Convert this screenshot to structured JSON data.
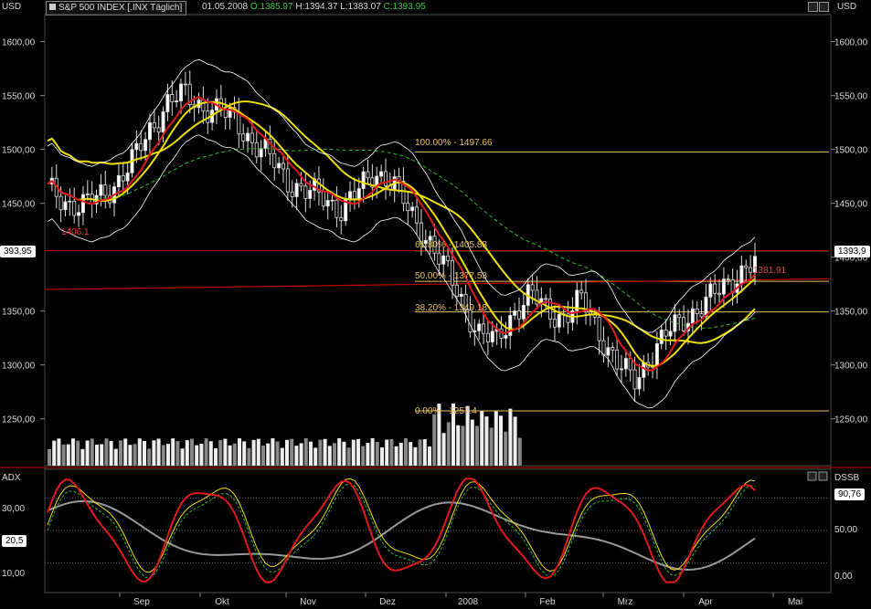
{
  "header": {
    "currency_left": "USD",
    "currency_right": "USD",
    "symbol": "S&P 500 INDEX [.INX  Täglich]",
    "date": "01.05.2008",
    "open": "O:1385.97",
    "high": "H:1394.37",
    "low": "L:1383.07",
    "close": "C:1393.95"
  },
  "price_panel": {
    "y_ticks": [
      "1600,00",
      "1550,00",
      "1500,00",
      "1450,00",
      "1350,00",
      "1300,00",
      "1250,00"
    ],
    "y_ticks_right": [
      "1600,00",
      "1550,00",
      "1500,00",
      "1450,00",
      "1400,00",
      "1350,00",
      "1300,00",
      "1250,00"
    ],
    "last_price_left": "393,95",
    "last_price_right": "1393,9",
    "resistance_label": "1406.1",
    "trendline_label": "1381.91",
    "fib_labels": [
      "100.00% - 1497.66",
      "61.80% - 1405.88",
      "50.00% - 1377.53",
      "38.20% - 1349.18",
      "0.00% - 1257.4"
    ]
  },
  "indicator_panel": {
    "left_label": "ADX",
    "right_label": "DSSB",
    "left_ticks": [
      "30,00",
      "10,00"
    ],
    "left_marker": "20,5",
    "right_ticks": [
      "50,00",
      "0,00"
    ],
    "right_marker": "90,76"
  },
  "x_axis": {
    "labels": [
      "Sep",
      "Okt",
      "Nov",
      "Dez",
      "2008",
      "Feb",
      "Mrz",
      "Apr",
      "Mai"
    ]
  },
  "colors": {
    "background": "#000000",
    "fib_line": "#e8c060",
    "ma_red": "#e0191c",
    "ma_yellow": "#f0e000",
    "ma_green_dash": "#2dbb2d",
    "band": "#ffffff",
    "adx": "#9a9a9a",
    "resistance": "#c00000"
  },
  "chart_data": {
    "type": "candlestick",
    "title": "S&P 500 INDEX [.INX  Täglich]",
    "xlabel": "",
    "ylabel": "USD",
    "ylim": [
      1215,
      1620
    ],
    "x_categories": [
      "Sep",
      "Okt",
      "Nov",
      "Dez",
      "2008",
      "Feb",
      "Mrz",
      "Apr",
      "Mai"
    ],
    "close_series_approx": [
      1462,
      1452,
      1448,
      1455,
      1470,
      1490,
      1520,
      1545,
      1550,
      1540,
      1535,
      1525,
      1505,
      1490,
      1470,
      1460,
      1455,
      1445,
      1460,
      1480,
      1470,
      1440,
      1420,
      1390,
      1360,
      1330,
      1320,
      1350,
      1365,
      1350,
      1345,
      1360,
      1330,
      1300,
      1285,
      1310,
      1330,
      1345,
      1355,
      1370,
      1385,
      1394
    ],
    "fibonacci_levels": [
      {
        "label": "100.00%",
        "value": 1497.66
      },
      {
        "label": "61.80%",
        "value": 1405.88
      },
      {
        "label": "50.00%",
        "value": 1377.53
      },
      {
        "label": "38.20%",
        "value": 1349.18
      },
      {
        "label": "0.00%",
        "value": 1257.4
      }
    ],
    "horizontal_lines": [
      {
        "value": 1406.1
      }
    ],
    "trendline_end": 1381.91,
    "last_close": 1393.95,
    "indicator": {
      "left_name": "ADX",
      "right_name": "DSSB",
      "left_range": [
        5,
        40
      ],
      "right_range": [
        0,
        100
      ],
      "last_adx": 20.5,
      "last_dssb": 90.76
    }
  }
}
